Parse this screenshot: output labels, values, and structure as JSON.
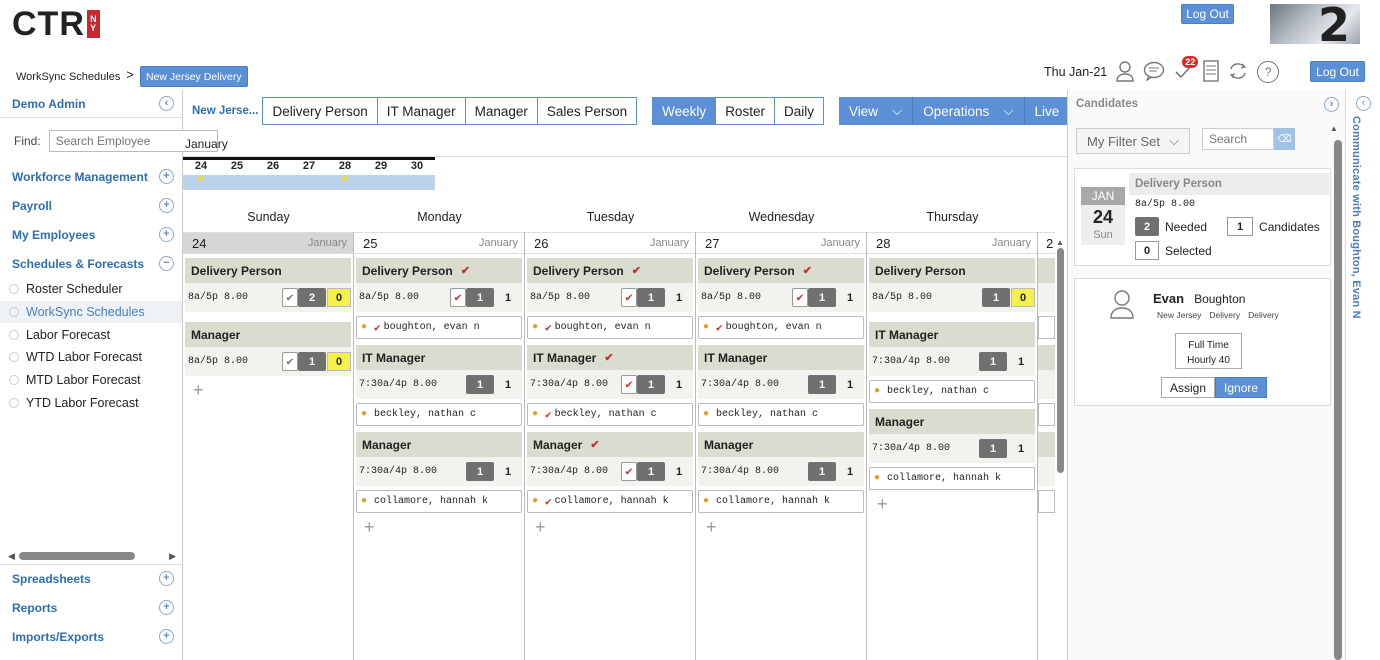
{
  "brand": {
    "logo": "CTR",
    "badge": "NY"
  },
  "header": {
    "logout_top": "Log Out",
    "logout": "Log Out",
    "date": "Thu Jan-21",
    "notif_count": "22"
  },
  "breadcrumb": {
    "root": "WorkSync Schedules",
    "sep": ">",
    "current": "New Jersey Delivery"
  },
  "sidebar": {
    "user": "Demo Admin",
    "find_label": "Find:",
    "search_placeholder": "Search Employee",
    "sections": [
      "Workforce Management",
      "Payroll",
      "My Employees"
    ],
    "schedules": "Schedules & Forecasts",
    "sub_items": [
      "Roster Scheduler",
      "WorkSync Schedules",
      "Labor Forecast",
      "WTD Labor Forecast",
      "MTD Labor Forecast",
      "YTD Labor Forecast"
    ],
    "bottom": [
      "Spreadsheets",
      "Reports",
      "Imports/Exports"
    ]
  },
  "toolbar": {
    "location": "New Jerse...",
    "roles": [
      "Delivery Person",
      "IT Manager",
      "Manager",
      "Sales Person"
    ],
    "views": [
      "Weekly",
      "Roster",
      "Daily"
    ],
    "menus": [
      "View",
      "Operations",
      "Live"
    ]
  },
  "calendar": {
    "month": "January",
    "strip_days": [
      "24",
      "25",
      "26",
      "27",
      "28",
      "29",
      "30"
    ],
    "day_names": [
      "Sunday",
      "Monday",
      "Tuesday",
      "Wednesday",
      "Thursday"
    ],
    "month_label": "January",
    "cols": [
      {
        "date": "24",
        "blocks": [
          {
            "title": "Delivery Person",
            "time": "8a/5p 8.00",
            "need": "2",
            "filled": "0",
            "emps": []
          },
          {
            "title": "Manager",
            "time": "8a/5p 8.00",
            "need": "1",
            "filled": "0",
            "emps": []
          }
        ]
      },
      {
        "date": "25",
        "blocks": [
          {
            "title": "Delivery Person",
            "time": "8a/5p 8.00",
            "need": "1",
            "count": "1",
            "emps": [
              "boughton, evan n"
            ]
          },
          {
            "title": "IT Manager",
            "time": "7:30a/4p 8.00",
            "need": "1",
            "count": "1",
            "emps": [
              "beckley, nathan c"
            ]
          },
          {
            "title": "Manager",
            "time": "7:30a/4p 8.00",
            "need": "1",
            "count": "1",
            "emps": [
              "collamore, hannah k"
            ]
          }
        ]
      },
      {
        "date": "26",
        "blocks": [
          {
            "title": "Delivery Person",
            "time": "8a/5p 8.00",
            "need": "1",
            "count": "1",
            "emps": [
              "boughton, evan n"
            ]
          },
          {
            "title": "IT Manager",
            "time": "7:30a/4p 8.00",
            "need": "1",
            "count": "1",
            "emps": [
              "beckley, nathan c"
            ]
          },
          {
            "title": "Manager",
            "time": "7:30a/4p 8.00",
            "need": "1",
            "count": "1",
            "emps": [
              "collamore, hannah k"
            ]
          }
        ]
      },
      {
        "date": "27",
        "blocks": [
          {
            "title": "Delivery Person",
            "time": "8a/5p 8.00",
            "need": "1",
            "count": "1",
            "emps": [
              "boughton, evan n"
            ]
          },
          {
            "title": "IT Manager",
            "time": "7:30a/4p 8.00",
            "need": "1",
            "count": "1",
            "emps": [
              "beckley, nathan c"
            ]
          },
          {
            "title": "Manager",
            "time": "7:30a/4p 8.00",
            "need": "1",
            "count": "1",
            "emps": [
              "collamore, hannah k"
            ]
          }
        ]
      },
      {
        "date": "28",
        "blocks": [
          {
            "title": "Delivery Person",
            "time": "8a/5p 8.00",
            "need": "1",
            "filled": "0",
            "emps": []
          },
          {
            "title": "IT Manager",
            "time": "7:30a/4p 8.00",
            "need": "1",
            "count": "1",
            "emps": [
              "beckley, nathan c"
            ]
          },
          {
            "title": "Manager",
            "time": "7:30a/4p 8.00",
            "need": "1",
            "count": "1",
            "emps": [
              "collamore, hannah k"
            ]
          }
        ]
      }
    ],
    "partial_date": "2"
  },
  "candidates": {
    "title": "Candidates",
    "filter": "My Filter Set",
    "search_placeholder": "Search",
    "shift": {
      "month": "JAN",
      "day": "24",
      "dow": "Sun",
      "role": "Delivery Person",
      "time": "8a/5p 8.00",
      "needed": "2",
      "needed_label": "Needed",
      "cands": "1",
      "cands_label": "Candidates",
      "selected": "0",
      "selected_label": "Selected"
    },
    "person": {
      "first": "Evan",
      "last": "Boughton",
      "tags": [
        "New Jersey",
        "Delivery",
        "Delivery"
      ],
      "type": "Full Time",
      "hours": "Hourly 40",
      "assign": "Assign",
      "ignore": "Ignore"
    },
    "side_text": "Communicate with Boughton, Evan N"
  }
}
